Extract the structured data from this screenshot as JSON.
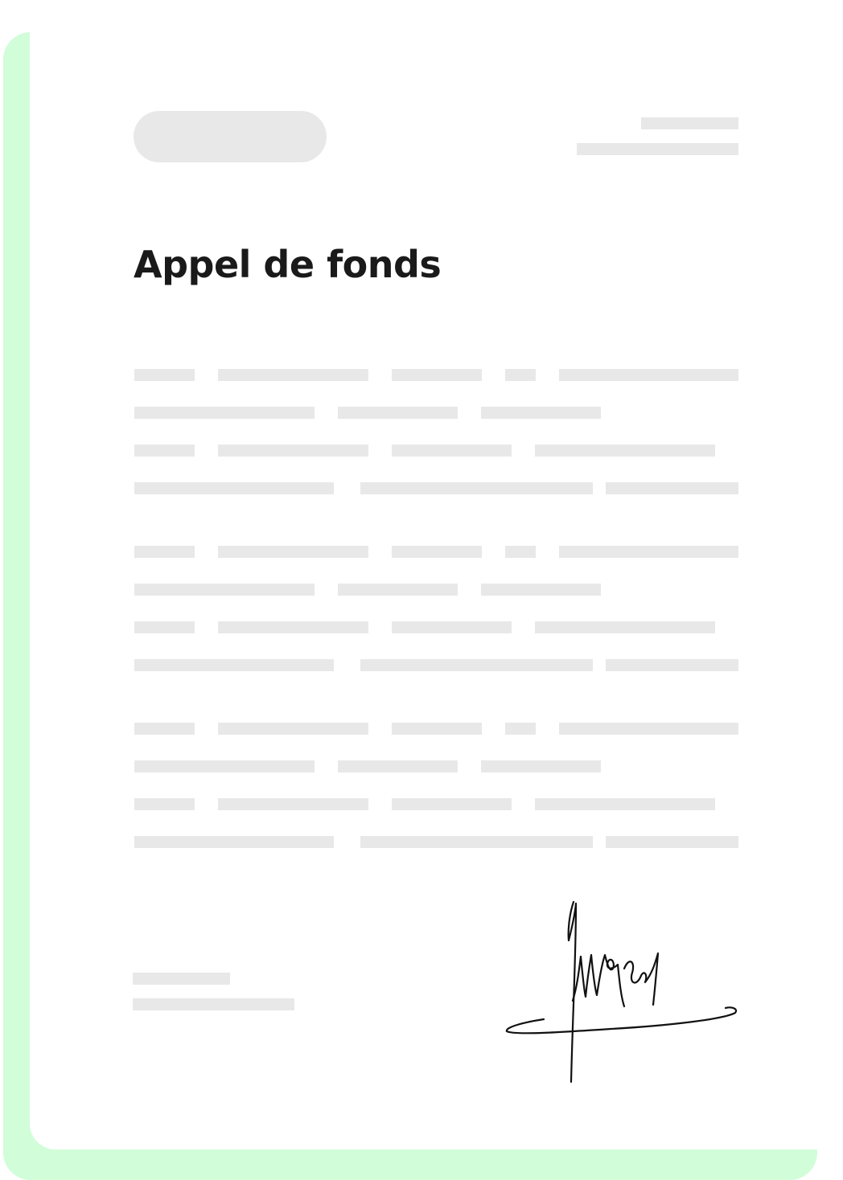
{
  "document": {
    "title": "Appel de fonds",
    "accent_color": "#d1fdd9",
    "placeholder_color": "#e8e8e8",
    "text_color": "#1a1a1a"
  },
  "signature": {
    "icon": "handwritten-signature"
  }
}
